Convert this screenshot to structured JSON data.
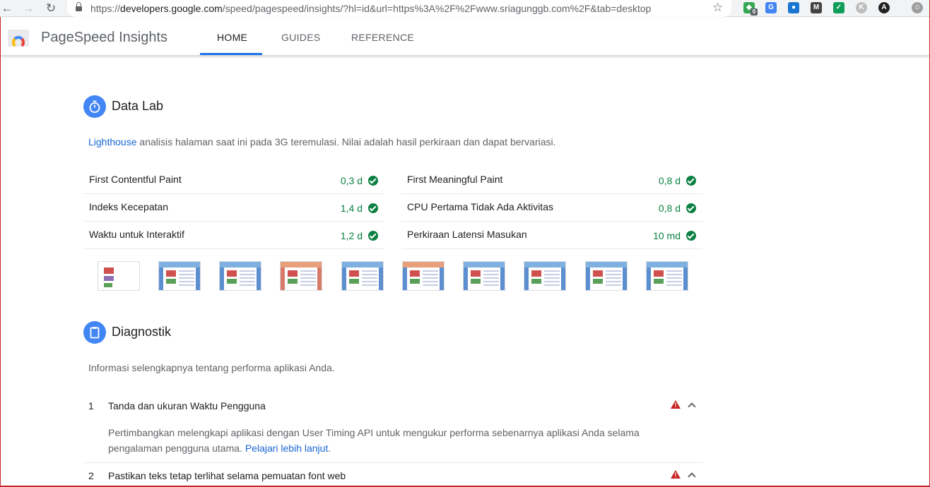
{
  "browser": {
    "url_prefix": "https://",
    "url_host": "developers.google.com",
    "url_rest": "/speed/pagespeed/insights/?hl=id&url=https%3A%2F%2Fwww.sriagunggb.com%2F&tab=desktop",
    "extension_badge": "0"
  },
  "header": {
    "brand": "PageSpeed Insights",
    "tabs": [
      {
        "label": "HOME",
        "active": true
      },
      {
        "label": "GUIDES",
        "active": false
      },
      {
        "label": "REFERENCE",
        "active": false
      }
    ]
  },
  "lab": {
    "title": "Data Lab",
    "desc_link": "Lighthouse",
    "desc_rest": " analisis halaman saat ini pada 3G teremulasi. Nilai adalah hasil perkiraan dan dapat bervariasi.",
    "metrics_left": [
      {
        "label": "First Contentful Paint",
        "value": "0,3 d"
      },
      {
        "label": "Indeks Kecepatan",
        "value": "1,4 d"
      },
      {
        "label": "Waktu untuk Interaktif",
        "value": "1,2 d"
      }
    ],
    "metrics_right": [
      {
        "label": "First Meaningful Paint",
        "value": "0,8 d"
      },
      {
        "label": "CPU Pertama Tidak Ada Aktivitas",
        "value": "0,8 d"
      },
      {
        "label": "Perkiraan Latensi Masukan",
        "value": "10 md"
      }
    ]
  },
  "diagnostics": {
    "title": "Diagnostik",
    "desc": "Informasi selengkapnya tentang performa aplikasi Anda.",
    "items": [
      {
        "num": "1",
        "title": "Tanda dan ukuran Waktu Pengguna",
        "body": "Pertimbangkan melengkapi aplikasi dengan User Timing API untuk mengukur performa sebenarnya aplikasi Anda selama pengalaman pengguna utama. ",
        "link": "Pelajari lebih lanjut",
        "tail": "."
      },
      {
        "num": "2",
        "title": "Pastikan teks tetap terlihat selama pemuatan font web"
      }
    ]
  },
  "colors": {
    "accent": "#1a73e8",
    "pass": "#0b8043",
    "warn": "#c5221f"
  }
}
